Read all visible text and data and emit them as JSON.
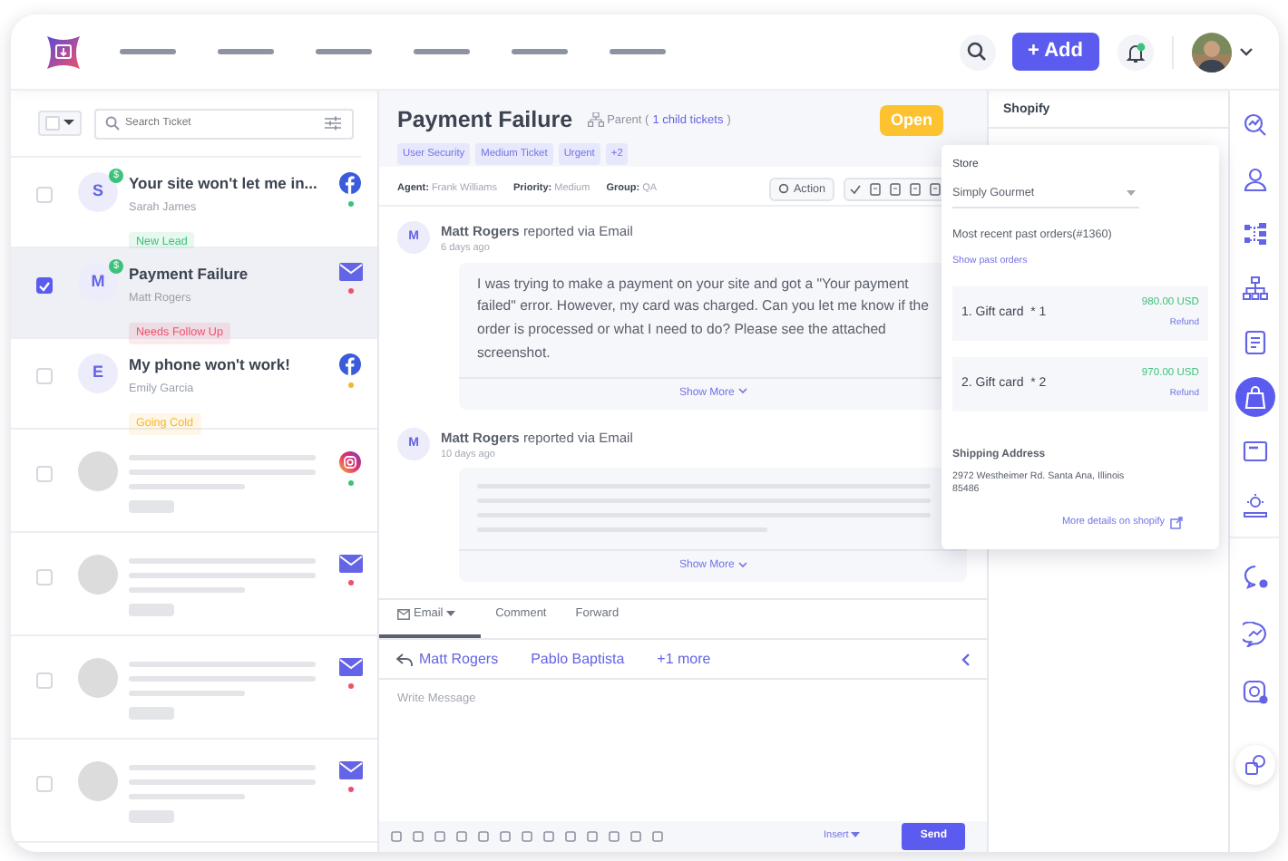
{
  "header": {
    "add_button": "+ Add",
    "notification_dot": true
  },
  "ticket_list": {
    "search": {
      "placeholder": "Search Ticket"
    },
    "tickets": [
      {
        "kind": "ticket",
        "checked": false,
        "selected": false,
        "avatar": "S",
        "badge": "$",
        "title": "Your site won't let me in...",
        "name": "Sarah James",
        "tag": {
          "label": "New Lead",
          "color": "#3dc27b"
        },
        "channel": {
          "kind": "facebook"
        },
        "color": "#3dc27b"
      },
      {
        "kind": "ticket",
        "checked": true,
        "selected": true,
        "avatar": "M",
        "badge": "$",
        "title": "Payment Failure",
        "name": "Matt Rogers",
        "tag": {
          "label": "Needs Follow Up",
          "color": "#f0506e"
        },
        "channel": {
          "kind": "email"
        },
        "color": "#f0506e"
      },
      {
        "kind": "ticket",
        "checked": false,
        "selected": false,
        "avatar": "E",
        "title": "My phone won't work!",
        "name": "Emily Garcia",
        "tag": {
          "label": "Going Cold",
          "color": "#f5b82e"
        },
        "channel": {
          "kind": "facebook"
        },
        "color": "#f5b82e"
      },
      {
        "kind": "placeholder",
        "checked": false,
        "selected": false,
        "channel": {
          "kind": "instagram"
        },
        "color": "#3dc27b"
      },
      {
        "kind": "placeholder",
        "checked": false,
        "selected": false,
        "channel": {
          "kind": "email"
        },
        "color": "#f0506e"
      },
      {
        "kind": "placeholder",
        "checked": false,
        "selected": false,
        "channel": {
          "kind": "email"
        },
        "color": "#f0506e"
      },
      {
        "kind": "placeholder",
        "checked": false,
        "selected": false,
        "channel": {
          "kind": "email"
        },
        "color": "#f0506e"
      }
    ]
  },
  "ticket": {
    "title": "Payment Failure",
    "parent_label": "Parent (",
    "child_link": "1 child tickets",
    "parent_close": ")",
    "status": "Open",
    "tags": [
      "User Security",
      "Medium Ticket",
      "Urgent",
      "+2"
    ],
    "meta": [
      "**Agent:** Frank Williams",
      "**Priority:** Medium",
      "**Group:** QA"
    ],
    "action_button": "Action",
    "messages": [
      {
        "kind": "text",
        "avatar": "M",
        "author": "Matt Rogers",
        "via": "reported via Email",
        "time": "6 days ago",
        "body": "I was trying to make a payment on your site and got a \"Your payment failed\" error. However, my card was charged. Can you let me know if the order is processed or what I need to do? Please see the attached screenshot.",
        "show_more": "Show More"
      },
      {
        "kind": "placeholder",
        "avatar": "M",
        "author": "Matt Rogers",
        "via": "reported via Email",
        "time": "10 days ago",
        "show_more": "Show More"
      }
    ]
  },
  "reply": {
    "tabs": [
      {
        "label": "Email",
        "selected": true
      },
      {
        "label": "Comment",
        "selected": false
      },
      {
        "label": "Forward",
        "selected": false
      }
    ],
    "recipients": [
      "Matt Rogers",
      "Pablo Baptista"
    ],
    "more": "+1 more",
    "placeholder": "Write Message",
    "insert": "Insert",
    "send": "Send"
  },
  "shopify": {
    "title": "Shopify",
    "store_label": "Store",
    "store": "Simply Gourmet",
    "recent": "Most recent past orders(#1360)",
    "show_past": "Show past orders",
    "orders": [
      {
        "name": "1. Gift card  * 1",
        "price": "980.00 USD",
        "refund": "Refund"
      },
      {
        "name": "2. Gift card  * 2",
        "price": "970.00 USD",
        "refund": "Refund"
      }
    ],
    "shipping_label": "Shipping Address",
    "address": "2972 Westheimer Rd. Santa Ana, Illinois 85486",
    "more_details": "More details on shopify"
  },
  "rail": [
    {
      "kind": "analytics",
      "selected": false
    },
    {
      "kind": "user",
      "selected": false
    },
    {
      "kind": "flow",
      "selected": false
    },
    {
      "kind": "hierarchy",
      "selected": false
    },
    {
      "kind": "notes",
      "selected": false
    },
    {
      "kind": "bag",
      "selected": true
    },
    {
      "kind": "window",
      "selected": false
    },
    {
      "kind": "idea",
      "selected": false
    }
  ],
  "rail_channels": [
    {
      "kind": "chat"
    },
    {
      "kind": "messenger"
    },
    {
      "kind": "instagram"
    }
  ]
}
